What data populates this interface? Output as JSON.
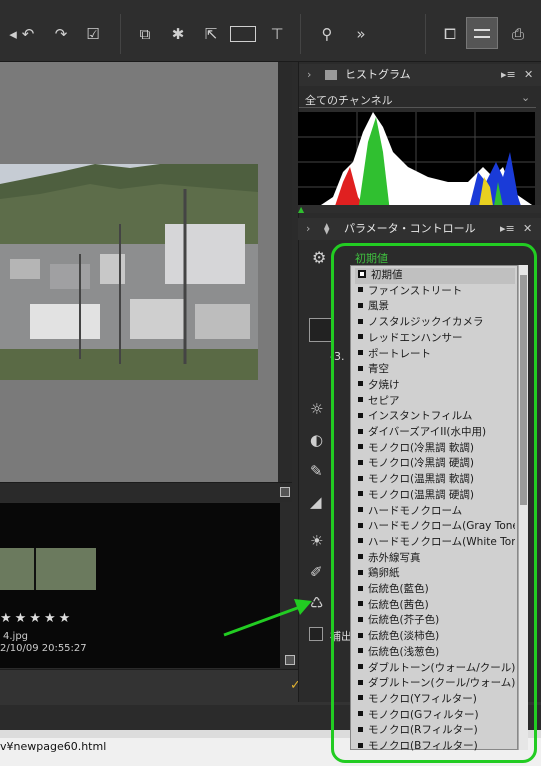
{
  "toolbar": {
    "icons": [
      "undo-icon",
      "rotate-left-icon",
      "rotate-right-icon",
      "checkbox-icon",
      "compare-icon",
      "batch-icon",
      "export-icon",
      "slideshow-icon",
      "hammer-icon",
      "zoom-icon",
      "more-icon",
      "window-icon",
      "sliders-icon",
      "printer-icon"
    ],
    "more_label": "»"
  },
  "histogram": {
    "title": "ヒストグラム",
    "channel": "全てのチャンネル"
  },
  "params": {
    "title": "パラメータ・コントロール",
    "preset_value": "初期値",
    "exposure_label": "-3.",
    "other_label": "補出"
  },
  "dropdown": {
    "items": [
      "初期値",
      "ファインストリート",
      "風景",
      "ノスタルジックイカメラ",
      "レッドエンハンサー",
      "ポートレート",
      "青空",
      "夕焼け",
      "セピア",
      "インスタントフィルム",
      "ダイバーズアイII(水中用)",
      "モノクロ(冷黒調 軟調)",
      "モノクロ(冷黒調 硬調)",
      "モノクロ(温黒調 軟調)",
      "モノクロ(温黒調 硬調)",
      "ハードモノクローム",
      "ハードモノクローム(Gray Tone)",
      "ハードモノクローム(White Tone)",
      "赤外線写真",
      "鶏卵紙",
      "伝統色(藍色)",
      "伝統色(茜色)",
      "伝統色(芥子色)",
      "伝統色(淡柿色)",
      "伝統色(浅葱色)",
      "ダブルトーン(ウォーム/クール)",
      "ダブルトーン(クール/ウォーム)",
      "モノクロ(Yフィルター)",
      "モノクロ(Gフィルター)",
      "モノクロ(Rフィルター)",
      "モノクロ(Bフィルター)"
    ],
    "selected": 0
  },
  "filmstrip": {
    "stars": "★★★★★",
    "filename": "4.jpg",
    "datetime": "2/10/09 20:55:27"
  },
  "statusbar": {
    "path": "v¥newpage60.html"
  },
  "colors": {
    "accent": "#22cc22",
    "dropdown_bg": "#d0d0d0"
  }
}
